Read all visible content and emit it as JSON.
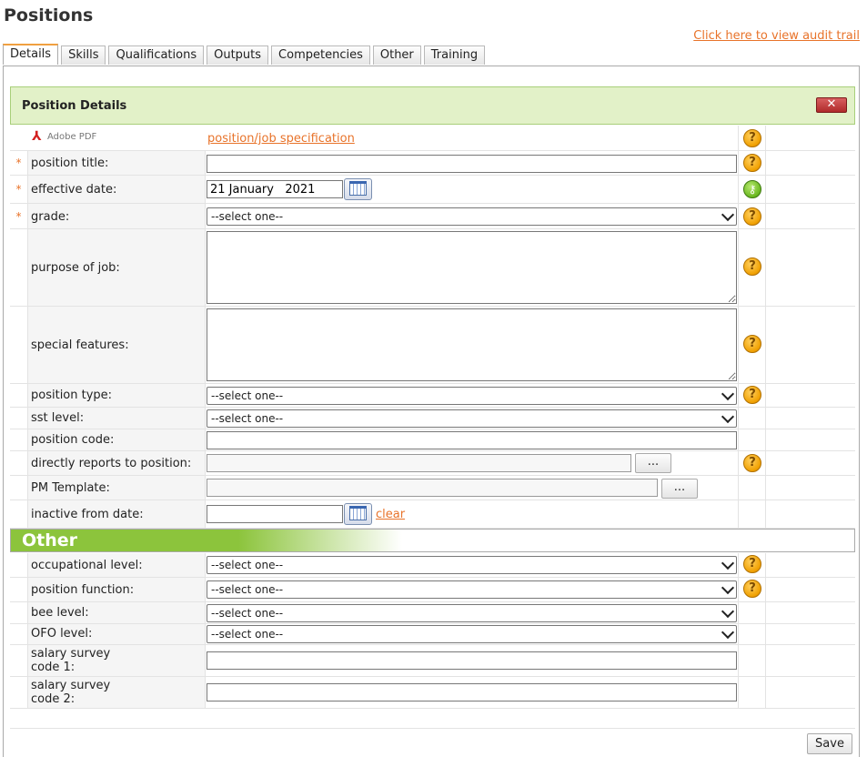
{
  "page": {
    "title": "Positions",
    "audit_link": "Click here to view audit trail"
  },
  "tabs": [
    "Details",
    "Skills",
    "Qualifications",
    "Outputs",
    "Competencies",
    "Other",
    "Training"
  ],
  "section": {
    "title": "Position Details",
    "close_label": "✕",
    "other_title": "Other"
  },
  "pdf": {
    "icon_label": "Adobe PDF",
    "link": "position/job specification"
  },
  "fields": {
    "position_title": {
      "label": "position title:",
      "value": ""
    },
    "effective_date": {
      "label": "effective date:",
      "value": "21 January   2021"
    },
    "grade": {
      "label": "grade:",
      "value": "--select one--"
    },
    "purpose_of_job": {
      "label": "purpose of job:",
      "value": ""
    },
    "special_features": {
      "label": "special features:",
      "value": ""
    },
    "position_type": {
      "label": "position type:",
      "value": "--select one--"
    },
    "sst_level": {
      "label": "sst level:",
      "value": "--select one--"
    },
    "position_code": {
      "label": "position code:",
      "value": ""
    },
    "directly_reports": {
      "label": "directly reports to position:",
      "value": "",
      "button": "..."
    },
    "pm_template": {
      "label": "PM Template:",
      "value": "",
      "button": "..."
    },
    "inactive_from": {
      "label": "inactive from date:",
      "value": "",
      "clear": "clear"
    },
    "occupational_level": {
      "label": "occupational level:",
      "value": "--select one--"
    },
    "position_function": {
      "label": "position function:",
      "value": "--select one--"
    },
    "bee_level": {
      "label": "bee level:",
      "value": "--select one--"
    },
    "ofo_level": {
      "label": "OFO level:",
      "value": "--select one--"
    },
    "salary_survey_1": {
      "label": "salary survey code 1:",
      "value": ""
    },
    "salary_survey_2": {
      "label": "salary survey code 2:",
      "value": ""
    }
  },
  "icons": {
    "help": "?",
    "key": "⚷",
    "required": "*"
  },
  "footer": {
    "save_label": "Save"
  },
  "colors": {
    "accent": "#e8732a",
    "section_bg": "#e2f1c8",
    "other_green": "#8cc43c"
  }
}
